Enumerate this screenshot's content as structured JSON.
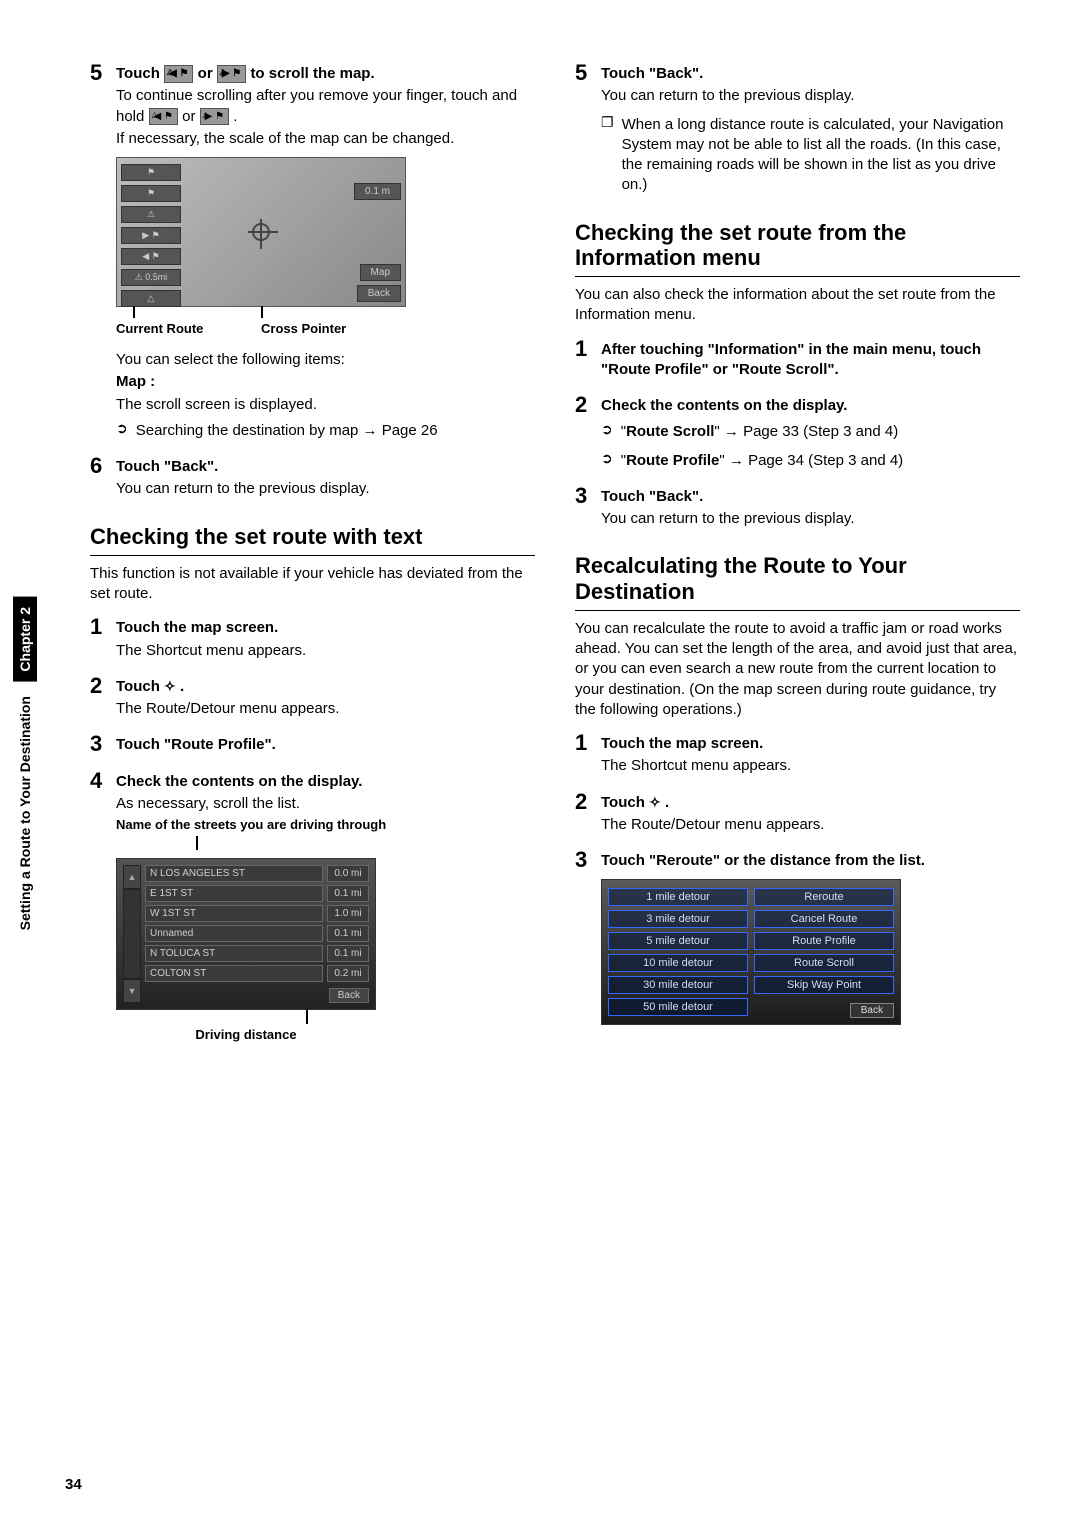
{
  "sidebar": {
    "chapter": "Chapter 2",
    "section": "Setting a Route to Your Destination"
  },
  "pageNumber": "34",
  "left": {
    "step5": {
      "title_a": "Touch ",
      "title_b": " or ",
      "title_c": " to scroll the map.",
      "p1": "To continue scrolling after you remove your finger, touch and hold ",
      "p1b": " or ",
      "p1c": ".",
      "p2": "If necessary, the scale of the map can be changed.",
      "caption1": "Current Route",
      "caption2": "Cross Pointer",
      "select": "You can select the following items:",
      "mapLabel": "Map :",
      "mapDesc": "The scroll screen is displayed.",
      "xref": "Searching the destination by map → Page 26",
      "mapButtons": {
        "scaleTop": "⚑",
        "scaleMid": "⚑",
        "warn": "⚠",
        "left": "▶ ⚑",
        "right": "◀ ⚑",
        "dist": "⚠  0.5mi",
        "compass": "△",
        "scaleBadge": "0.1 m",
        "mapBtn": "Map",
        "backBtn": "Back"
      }
    },
    "step6": {
      "title": "Touch \"Back\".",
      "desc": "You can return to the previous display."
    },
    "h2a": "Checking the set route with text",
    "h2a_desc": "This function is not available if your vehicle has deviated from the set route.",
    "a1": {
      "title": "Touch the map screen.",
      "desc": "The Shortcut menu appears."
    },
    "a2": {
      "title_a": "Touch ",
      "title_b": ".",
      "desc": "The Route/Detour menu appears."
    },
    "a3": {
      "title": "Touch \"Route Profile\"."
    },
    "a4": {
      "title": "Check the contents on the display.",
      "desc": "As necessary, scroll the list.",
      "caption_top": "Name of the streets you are driving through",
      "caption_bottom": "Driving distance",
      "rows": [
        {
          "name": "N LOS ANGELES ST",
          "dist": "0.0  mi"
        },
        {
          "name": "E 1ST ST",
          "dist": "0.1  mi"
        },
        {
          "name": "W 1ST ST",
          "dist": "1.0  mi"
        },
        {
          "name": "Unnamed",
          "dist": "0.1  mi"
        },
        {
          "name": "N TOLUCA ST",
          "dist": "0.1  mi"
        },
        {
          "name": "COLTON ST",
          "dist": "0.2  mi"
        }
      ],
      "back": "Back"
    }
  },
  "right": {
    "step5": {
      "title": "Touch \"Back\".",
      "desc": "You can return to the previous display.",
      "note": "When a long distance route is calculated, your Navigation System may not be able to list all the roads. (In this case, the remaining roads will be shown in the list as you drive on.)"
    },
    "h2b": "Checking the set route from the Information menu",
    "h2b_desc": "You can also check the information about the set route from the Information menu.",
    "b1": {
      "title": "After touching \"Information\" in the main menu, touch \"Route Profile\" or \"Route Scroll\"."
    },
    "b2": {
      "title": "Check the contents on the display.",
      "x1a": "\"",
      "x1b": "Route Scroll",
      "x1c": "\" → Page 33 (Step 3 and 4)",
      "x2a": "\"",
      "x2b": "Route Profile",
      "x2c": "\" → Page 34 (Step 3 and 4)"
    },
    "b3": {
      "title": "Touch \"Back\".",
      "desc": "You can return to the previous display."
    },
    "h2c": "Recalculating the Route to Your Destination",
    "h2c_desc": "You can recalculate the route to avoid a traffic jam or road works ahead. You can set the length of the area, and avoid just that area, or you can even search a new route from the current location to your destination. (On the map screen during route guidance, try the following operations.)",
    "c1": {
      "title": "Touch the map screen.",
      "desc": "The Shortcut menu appears."
    },
    "c2": {
      "title_a": "Touch ",
      "title_b": ".",
      "desc": "The Route/Detour menu appears."
    },
    "c3": {
      "title": "Touch \"Reroute\" or the distance from the list.",
      "leftBtns": [
        "1 mile detour",
        "3 mile detour",
        "5 mile detour",
        "10 mile detour",
        "30 mile detour",
        "50 mile detour"
      ],
      "rightBtns": [
        "Reroute",
        "Cancel Route",
        "Route Profile",
        "Route Scroll",
        "Skip Way Point"
      ],
      "back": "Back"
    }
  }
}
